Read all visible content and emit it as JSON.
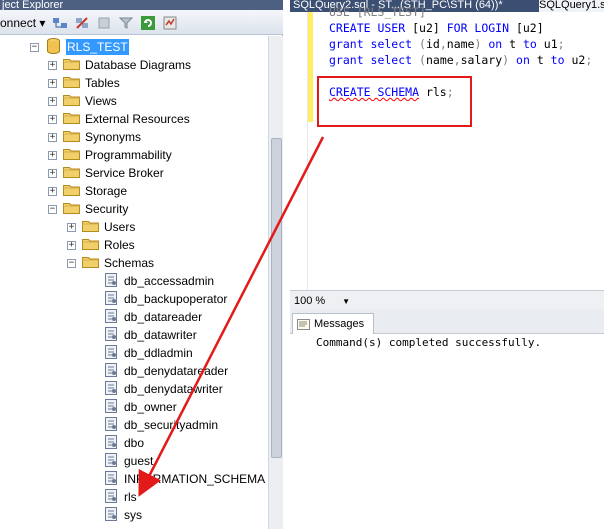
{
  "object_explorer": {
    "title": "ject Explorer",
    "connect_label": "onnect ▾",
    "tree": [
      {
        "label": "RLS_TEST",
        "type": "database",
        "expander": "−",
        "selected": true
      },
      {
        "label": "Database Diagrams",
        "type": "folder",
        "expander": "+"
      },
      {
        "label": "Tables",
        "type": "folder",
        "expander": "+"
      },
      {
        "label": "Views",
        "type": "folder",
        "expander": "+"
      },
      {
        "label": "External Resources",
        "type": "folder",
        "expander": "+"
      },
      {
        "label": "Synonyms",
        "type": "folder",
        "expander": "+"
      },
      {
        "label": "Programmability",
        "type": "folder",
        "expander": "+"
      },
      {
        "label": "Service Broker",
        "type": "folder",
        "expander": "+"
      },
      {
        "label": "Storage",
        "type": "folder",
        "expander": "+"
      },
      {
        "label": "Security",
        "type": "folder",
        "expander": "−"
      },
      {
        "label": "Users",
        "type": "folder",
        "expander": "+"
      },
      {
        "label": "Roles",
        "type": "folder",
        "expander": "+"
      },
      {
        "label": "Schemas",
        "type": "folder",
        "expander": "−"
      },
      {
        "label": "db_accessadmin",
        "type": "schema"
      },
      {
        "label": "db_backupoperator",
        "type": "schema"
      },
      {
        "label": "db_datareader",
        "type": "schema"
      },
      {
        "label": "db_datawriter",
        "type": "schema"
      },
      {
        "label": "db_ddladmin",
        "type": "schema"
      },
      {
        "label": "db_denydatareader",
        "type": "schema"
      },
      {
        "label": "db_denydatawriter",
        "type": "schema"
      },
      {
        "label": "db_owner",
        "type": "schema"
      },
      {
        "label": "db_securityadmin",
        "type": "schema"
      },
      {
        "label": "dbo",
        "type": "schema"
      },
      {
        "label": "guest",
        "type": "schema"
      },
      {
        "label": "INFORMATION_SCHEMA",
        "type": "schema"
      },
      {
        "label": "rls",
        "type": "schema"
      },
      {
        "label": "sys",
        "type": "schema"
      }
    ]
  },
  "editor": {
    "tab_active": "SQLQuery2.sql - ST...(STH_PC\\STH (64))*",
    "tab_other": "SQLQuery1.s",
    "zoom": "100 %",
    "messages_tab": "Messages",
    "message": "Command(s) completed successfully.",
    "highlight_color": "#e21a1a"
  }
}
